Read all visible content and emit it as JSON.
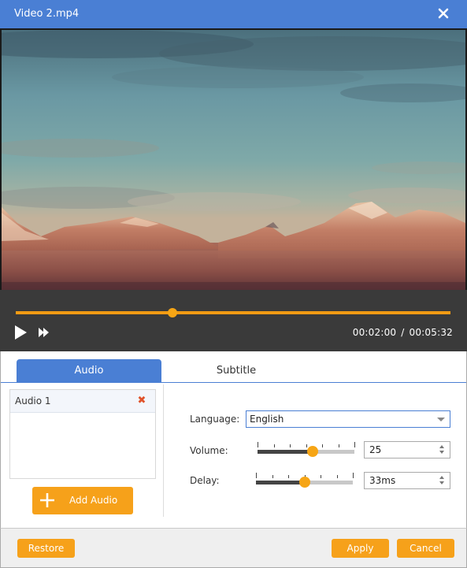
{
  "window": {
    "title": "Video 2.mp4",
    "close_icon": "close-icon"
  },
  "player": {
    "progress_fraction": 0.36,
    "current_time": "00:02:00",
    "separator": "/",
    "total_time": "00:05:32",
    "play_icon": "play-icon",
    "fast_forward_icon": "fast-forward-icon",
    "accent_color": "#f29b14"
  },
  "tabs": [
    {
      "label": "Audio",
      "active": true
    },
    {
      "label": "Subtitle",
      "active": false
    }
  ],
  "audio_tracks": {
    "items": [
      {
        "label": "Audio 1",
        "remove_icon": "✖"
      }
    ],
    "add_label": "Add Audio",
    "add_icon": "plus-icon"
  },
  "settings": {
    "language": {
      "label": "Language:",
      "value": "English"
    },
    "volume": {
      "label": "Volume:",
      "value": "25",
      "slider_fraction": 0.57,
      "tick_count": 7
    },
    "delay": {
      "label": "Delay:",
      "value": "33ms",
      "slider_fraction": 0.5,
      "tick_count": 7
    }
  },
  "footer": {
    "restore_label": "Restore",
    "apply_label": "Apply",
    "cancel_label": "Cancel"
  },
  "colors": {
    "title_bar": "#4a7fd4",
    "button": "#f6a11a",
    "remove_icon": "#e0522a"
  }
}
